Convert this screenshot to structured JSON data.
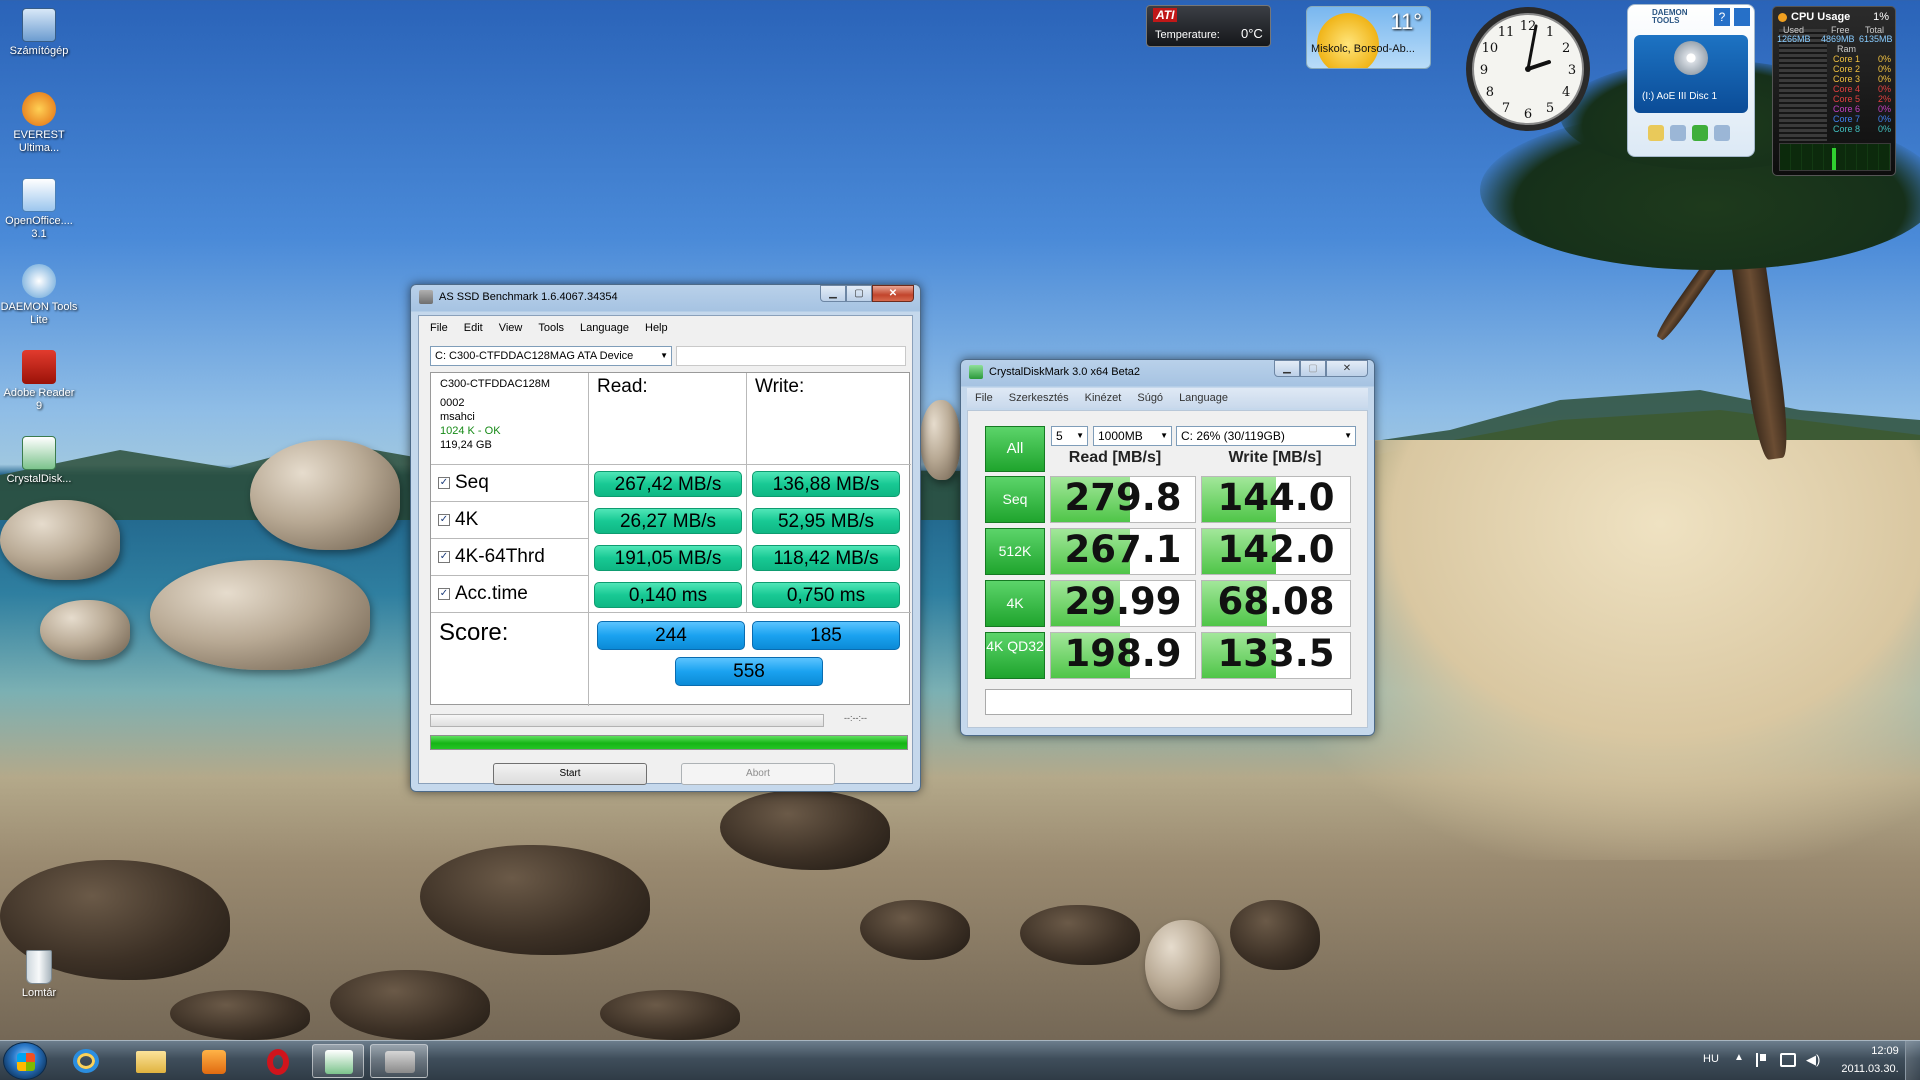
{
  "desktop": {
    "icons": [
      {
        "label": "Számítógép",
        "icon": "computer-icon"
      },
      {
        "label": "EVEREST Ultima...",
        "icon": "everest-icon"
      },
      {
        "label": "OpenOffice.... 3.1",
        "icon": "openoffice-icon"
      },
      {
        "label": "DAEMON Tools Lite",
        "icon": "daemon-tools-icon"
      },
      {
        "label": "Adobe Reader 9",
        "icon": "adobe-reader-icon"
      },
      {
        "label": "CrystalDisk...",
        "icon": "crystaldisk-icon"
      },
      {
        "label": "Lomtár",
        "icon": "recycle-bin-icon"
      }
    ]
  },
  "gadgets": {
    "ati": {
      "brand": "ATI",
      "label": "Temperature:",
      "value": "0°C"
    },
    "weather": {
      "temp": "11°",
      "location": "Miskolc, Borsod-Ab..."
    },
    "daemon": {
      "title": "DAEMON TOOLS",
      "drive": "(I:) AoE III Disc 1"
    },
    "cpu": {
      "title": "CPU Usage",
      "value": "1%",
      "mem_headers": [
        "Used",
        "Free",
        "Total"
      ],
      "mem_values": [
        "1266MB",
        "4869MB",
        "6135MB"
      ],
      "mem_label": "Ram",
      "cores": [
        {
          "name": "Core 1",
          "val": "0%"
        },
        {
          "name": "Core 2",
          "val": "0%"
        },
        {
          "name": "Core 3",
          "val": "0%"
        },
        {
          "name": "Core 4",
          "val": "0%"
        },
        {
          "name": "Core 5",
          "val": "2%"
        },
        {
          "name": "Core 6",
          "val": "0%"
        },
        {
          "name": "Core 7",
          "val": "0%"
        },
        {
          "name": "Core 8",
          "val": "0%"
        }
      ]
    },
    "clock": {
      "numbers": [
        "12",
        "1",
        "2",
        "3",
        "4",
        "5",
        "6",
        "7",
        "8",
        "9",
        "10",
        "11"
      ]
    }
  },
  "asssd": {
    "title": "AS SSD Benchmark 1.6.4067.34354",
    "menu": [
      "File",
      "Edit",
      "View",
      "Tools",
      "Language",
      "Help"
    ],
    "drive_select": "C: C300-CTFDDAC128MAG ATA Device",
    "info": {
      "model": "C300-CTFDDAC128M",
      "firmware": "0002",
      "driver": "msahci",
      "align": "1024 K - OK",
      "size": "119,24 GB"
    },
    "read_header": "Read:",
    "write_header": "Write:",
    "rows": [
      {
        "label": "Seq",
        "read": "267,42 MB/s",
        "write": "136,88 MB/s"
      },
      {
        "label": "4K",
        "read": "26,27 MB/s",
        "write": "52,95 MB/s"
      },
      {
        "label": "4K-64Thrd",
        "read": "191,05 MB/s",
        "write": "118,42 MB/s"
      },
      {
        "label": "Acc.time",
        "read": "0,140 ms",
        "write": "0,750 ms"
      }
    ],
    "score_label": "Score:",
    "score_read": "244",
    "score_write": "185",
    "score_total": "558",
    "time": "--:--:--",
    "progress": 1.0,
    "start": "Start",
    "abort": "Abort",
    "check": "✓"
  },
  "cdm": {
    "title": "CrystalDiskMark 3.0 x64 Beta2",
    "menu": [
      "File",
      "Szerkesztés",
      "Kinézet",
      "Súgó",
      "Language"
    ],
    "all": "All",
    "count": "5",
    "size": "1000MB",
    "drive": "C: 26% (30/119GB)",
    "read_header": "Read [MB/s]",
    "write_header": "Write [MB/s]",
    "rows": [
      {
        "label": "Seq",
        "read": "279.8",
        "write": "144.0",
        "read_fill": 0.55,
        "write_fill": 0.5
      },
      {
        "label": "512K",
        "read": "267.1",
        "write": "142.0",
        "read_fill": 0.55,
        "write_fill": 0.5
      },
      {
        "label": "4K",
        "read": "29.99",
        "write": "68.08",
        "read_fill": 0.48,
        "write_fill": 0.44
      },
      {
        "label": "4K QD32",
        "read": "198.9",
        "write": "133.5",
        "read_fill": 0.55,
        "write_fill": 0.5
      }
    ]
  },
  "taskbar": {
    "lang": "HU",
    "time": "12:09",
    "date": "2011.03.30."
  },
  "colors": {
    "accent_green": "#18c994",
    "accent_blue": "#1aa2f0",
    "cdm_green": "#1fa42d"
  }
}
